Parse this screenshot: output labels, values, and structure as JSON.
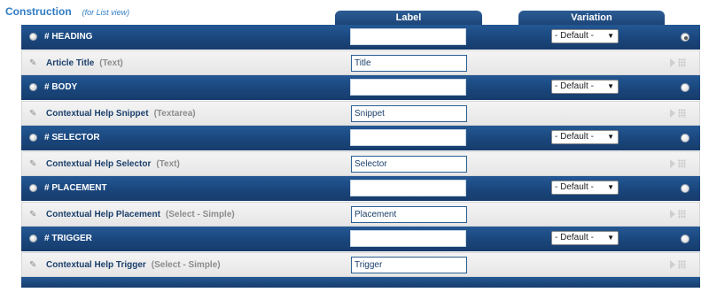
{
  "header": {
    "title": "Construction",
    "subtitle": "(for List view)"
  },
  "columns": {
    "label": "Label",
    "variation": "Variation"
  },
  "groups": [
    {
      "heading": "# HEADING",
      "heading_label_value": "",
      "variation": "- Default -",
      "selected": true,
      "field": {
        "name": "Article Title",
        "type": "(Text)",
        "label_value": "Title"
      }
    },
    {
      "heading": "# BODY",
      "heading_label_value": "",
      "variation": "- Default -",
      "selected": false,
      "field": {
        "name": "Contextual Help Snippet",
        "type": "(Textarea)",
        "label_value": "Snippet"
      }
    },
    {
      "heading": "# SELECTOR",
      "heading_label_value": "",
      "variation": "- Default -",
      "selected": false,
      "field": {
        "name": "Contextual Help Selector",
        "type": "(Text)",
        "label_value": "Selector"
      }
    },
    {
      "heading": "# PLACEMENT",
      "heading_label_value": "",
      "variation": "- Default -",
      "selected": false,
      "field": {
        "name": "Contextual Help Placement",
        "type": "(Select - Simple)",
        "label_value": "Placement"
      }
    },
    {
      "heading": "# TRIGGER",
      "heading_label_value": "",
      "variation": "- Default -",
      "selected": false,
      "field": {
        "name": "Contextual Help Trigger",
        "type": "(Select - Simple)",
        "label_value": "Trigger"
      }
    }
  ],
  "icons": {
    "row_radio": "radio-icon",
    "edit": "pencil-icon",
    "drag": "drag-handle-icon",
    "select_arrow": "chevron-down-icon"
  },
  "colors": {
    "header_blue": "#1a467c",
    "title_blue": "#2f7cc4",
    "field_row_bg": "#ececec",
    "field_type_grey": "#8c8c8c"
  }
}
